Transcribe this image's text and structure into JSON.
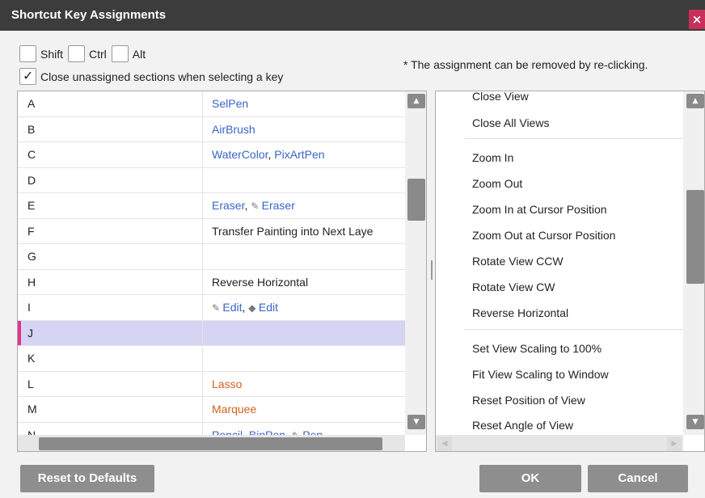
{
  "window": {
    "title": "Shortcut Key Assignments",
    "close_glyph": "×"
  },
  "modifiers": [
    {
      "label": "Shift",
      "checked": false
    },
    {
      "label": "Ctrl",
      "checked": false
    },
    {
      "label": "Alt",
      "checked": false
    }
  ],
  "close_unassigned": {
    "label": "Close unassigned sections when selecting a key",
    "checked": true
  },
  "note": "* The assignment can be removed by re-clicking.",
  "keys": [
    {
      "key": "A",
      "parts": [
        {
          "text": "SelPen",
          "color": "blue"
        }
      ]
    },
    {
      "key": "B",
      "parts": [
        {
          "text": "AirBrush",
          "color": "blue"
        }
      ]
    },
    {
      "key": "C",
      "parts": [
        {
          "text": "WaterColor",
          "color": "blue"
        },
        {
          "text": ", ",
          "color": "dark"
        },
        {
          "text": "PixArtPen",
          "color": "blue"
        }
      ]
    },
    {
      "key": "D",
      "parts": []
    },
    {
      "key": "E",
      "parts": [
        {
          "text": "Eraser",
          "color": "blue"
        },
        {
          "text": ", ",
          "color": "dark"
        },
        {
          "text": "✎ ",
          "color": "pen"
        },
        {
          "text": "Eraser",
          "color": "blue"
        }
      ]
    },
    {
      "key": "F",
      "parts": [
        {
          "text": "Transfer Painting into Next Laye",
          "color": "dark"
        }
      ]
    },
    {
      "key": "G",
      "parts": []
    },
    {
      "key": "H",
      "parts": [
        {
          "text": "Reverse Horizontal",
          "color": "dark"
        }
      ]
    },
    {
      "key": "I",
      "parts": [
        {
          "text": "✎ ",
          "color": "pen"
        },
        {
          "text": "Edit",
          "color": "blue"
        },
        {
          "text": ", ",
          "color": "dark"
        },
        {
          "text": "◆ ",
          "color": "pen"
        },
        {
          "text": "Edit",
          "color": "blue"
        }
      ]
    },
    {
      "key": "J",
      "parts": [],
      "selected": true
    },
    {
      "key": "K",
      "parts": []
    },
    {
      "key": "L",
      "parts": [
        {
          "text": "Lasso",
          "color": "orange"
        }
      ]
    },
    {
      "key": "M",
      "parts": [
        {
          "text": "Marquee",
          "color": "orange"
        }
      ]
    },
    {
      "key": "N",
      "parts": [
        {
          "text": "Pencil",
          "color": "blue"
        },
        {
          "text": ", ",
          "color": "dark"
        },
        {
          "text": "BinPen",
          "color": "blue"
        },
        {
          "text": ", ",
          "color": "dark"
        },
        {
          "text": "✎ ",
          "color": "pen"
        },
        {
          "text": "Pen",
          "color": "blue"
        }
      ]
    }
  ],
  "commands": [
    "Close View",
    "Close All Views",
    "Zoom In",
    "Zoom Out",
    "Zoom In at Cursor Position",
    "Zoom Out at Cursor Position",
    "Rotate View CCW",
    "Rotate View CW",
    "Reverse Horizontal",
    "Set View Scaling to 100%",
    "Fit View Scaling to Window",
    "Reset Position of View",
    "Reset Angle of View"
  ],
  "buttons": {
    "reset": "Reset to Defaults",
    "ok": "OK",
    "cancel": "Cancel"
  },
  "colors": {
    "title_bg": "#3c3c3c",
    "close_bg": "#c8305a",
    "selection": "#d6d4f3",
    "selection_mark": "#e0358a",
    "link": "#3a64c8",
    "tool_orange": "#d2611e"
  },
  "scroll": {
    "left_position_fraction": 0.3,
    "right_position_fraction": 0.4
  }
}
